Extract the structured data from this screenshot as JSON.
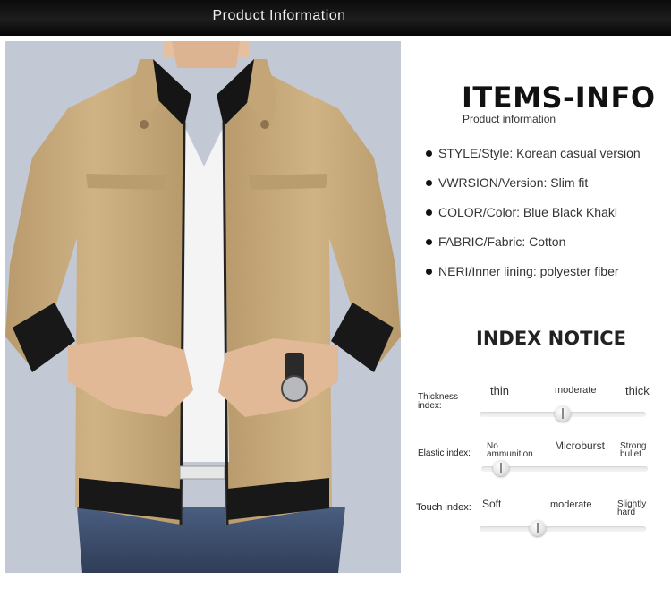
{
  "header": {
    "title": "Product Information"
  },
  "info": {
    "title": "ITEMS-INFO",
    "subtitle": "Product information",
    "specs": [
      "STYLE/Style: Korean casual version",
      "VWRSION/Version: Slim fit",
      "COLOR/Color: Blue Black Khaki",
      "FABRIC/Fabric: Cotton",
      "NERI/Inner lining: polyester fiber"
    ]
  },
  "notice": {
    "title": "INDEX NOTICE",
    "indexes": [
      {
        "label_line1": "Thickness",
        "label_line2": "index:",
        "left_line1": "thin",
        "left_line2": "",
        "mid": "moderate",
        "right_line1": "thick",
        "right_line2": "",
        "level_percent": 50
      },
      {
        "label_line1": "Elastic index:",
        "label_line2": "",
        "left_line1": "No",
        "left_line2": "ammunition",
        "mid": "Microburst",
        "right_line1": "Strong",
        "right_line2": "bullet",
        "level_percent": 12
      },
      {
        "label_line1": "Touch index:",
        "label_line2": "",
        "left_line1": "Soft",
        "left_line2": "",
        "mid": "moderate",
        "right_line1": "Slightly",
        "right_line2": "hard",
        "level_percent": 35
      }
    ]
  },
  "colors": {
    "header_bg": "#111111",
    "photo_bg": "#c3c9d4",
    "jacket_khaki": "#c7aa7c",
    "rib_black": "#181818"
  },
  "image": {
    "subject": "product-photo-khaki-jacket"
  }
}
